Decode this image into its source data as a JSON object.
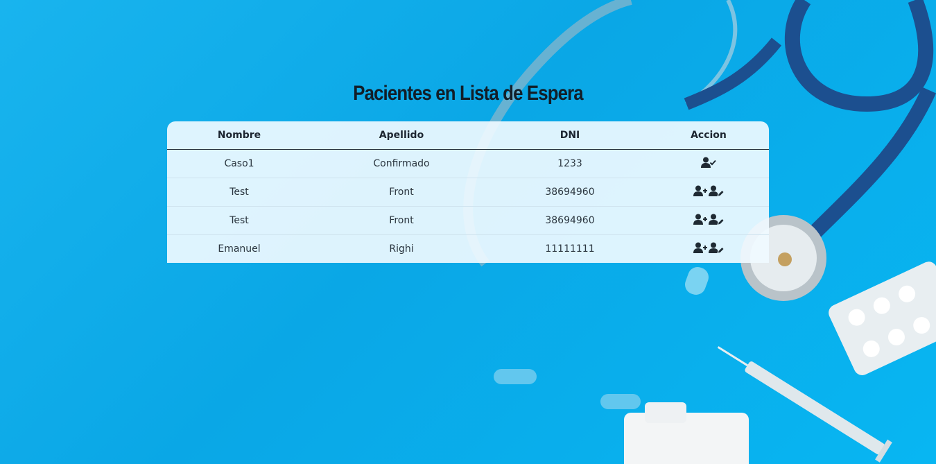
{
  "page": {
    "title": "Pacientes en Lista de Espera"
  },
  "table": {
    "headers": {
      "nombre": "Nombre",
      "apellido": "Apellido",
      "dni": "DNI",
      "accion": "Accion"
    },
    "rows": [
      {
        "nombre": "Caso1",
        "apellido": "Confirmado",
        "dni": "1233",
        "actions": [
          "user-check-icon"
        ]
      },
      {
        "nombre": "Test",
        "apellido": "Front",
        "dni": "38694960",
        "actions": [
          "user-plus-icon",
          "user-edit-icon"
        ]
      },
      {
        "nombre": "Test",
        "apellido": "Front",
        "dni": "38694960",
        "actions": [
          "user-plus-icon",
          "user-edit-icon"
        ]
      },
      {
        "nombre": "Emanuel",
        "apellido": "Righi",
        "dni": "11111111",
        "actions": [
          "user-plus-icon",
          "user-edit-icon"
        ]
      }
    ]
  },
  "colors": {
    "background": "#0aa7e6",
    "title": "#121e28",
    "icon": "#1f2a33"
  }
}
